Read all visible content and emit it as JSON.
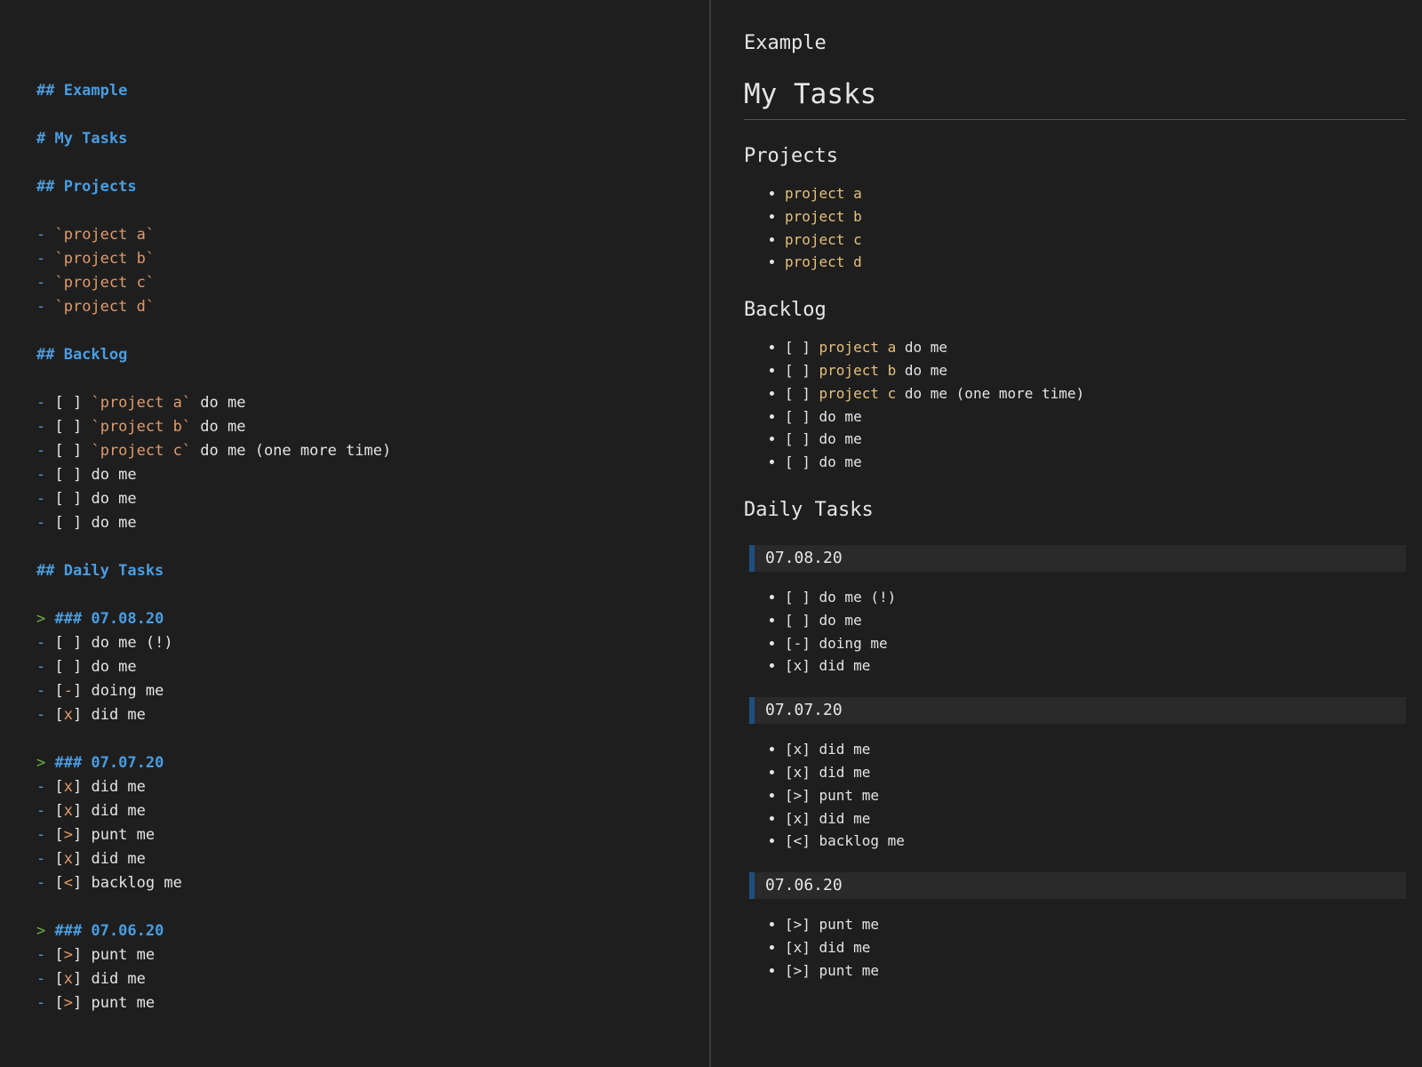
{
  "editor": {
    "lines": [
      {
        "k": "blank"
      },
      {
        "k": "h",
        "t": "## Example"
      },
      {
        "k": "blank"
      },
      {
        "k": "h",
        "t": "# My Tasks"
      },
      {
        "k": "blank"
      },
      {
        "k": "h",
        "t": "## Projects"
      },
      {
        "k": "blank"
      },
      {
        "k": "li",
        "code": "`project a`"
      },
      {
        "k": "li",
        "code": "`project b`"
      },
      {
        "k": "li",
        "code": "`project c`"
      },
      {
        "k": "li",
        "code": "`project d`"
      },
      {
        "k": "blank"
      },
      {
        "k": "h",
        "t": "## Backlog"
      },
      {
        "k": "blank"
      },
      {
        "k": "task",
        "box": " ",
        "code": "`project a`",
        "t": " do me"
      },
      {
        "k": "task",
        "box": " ",
        "code": "`project b`",
        "t": " do me"
      },
      {
        "k": "task",
        "box": " ",
        "code": "`project c`",
        "t": " do me (one more time)"
      },
      {
        "k": "task",
        "box": " ",
        "t": "do me"
      },
      {
        "k": "task",
        "box": " ",
        "t": "do me"
      },
      {
        "k": "task",
        "box": " ",
        "t": "do me"
      },
      {
        "k": "blank"
      },
      {
        "k": "h",
        "t": "## Daily Tasks"
      },
      {
        "k": "blank"
      },
      {
        "k": "bqh",
        "t": "### 07.08.20"
      },
      {
        "k": "task",
        "box": " ",
        "t": "do me (!)"
      },
      {
        "k": "task",
        "box": " ",
        "t": "do me"
      },
      {
        "k": "task",
        "box": "-",
        "t": "doing me"
      },
      {
        "k": "task",
        "box": "x",
        "t": "did me"
      },
      {
        "k": "blank"
      },
      {
        "k": "bqh",
        "t": "### 07.07.20"
      },
      {
        "k": "task",
        "box": "x",
        "t": "did me"
      },
      {
        "k": "task",
        "box": "x",
        "t": "did me"
      },
      {
        "k": "task",
        "box": ">",
        "t": "punt me"
      },
      {
        "k": "task",
        "box": "x",
        "t": "did me"
      },
      {
        "k": "task",
        "box": "<",
        "t": "backlog me"
      },
      {
        "k": "blank"
      },
      {
        "k": "bqh",
        "t": "### 07.06.20"
      },
      {
        "k": "task",
        "box": ">",
        "t": "punt me"
      },
      {
        "k": "task",
        "box": "x",
        "t": "did me"
      },
      {
        "k": "task",
        "box": ">",
        "t": "punt me"
      }
    ]
  },
  "preview": {
    "example": "Example",
    "title": "My Tasks",
    "projects_heading": "Projects",
    "projects": [
      "project a",
      "project b",
      "project c",
      "project d"
    ],
    "backlog_heading": "Backlog",
    "backlog": [
      {
        "box": "[ ]",
        "code": "project a",
        "t": "do me"
      },
      {
        "box": "[ ]",
        "code": "project b",
        "t": "do me"
      },
      {
        "box": "[ ]",
        "code": "project c",
        "t": "do me (one more time)"
      },
      {
        "box": "[ ]",
        "t": "do me"
      },
      {
        "box": "[ ]",
        "t": "do me"
      },
      {
        "box": "[ ]",
        "t": "do me"
      }
    ],
    "daily_heading": "Daily Tasks",
    "days": [
      {
        "date": "07.08.20",
        "items": [
          {
            "box": "[ ]",
            "t": "do me (!)"
          },
          {
            "box": "[ ]",
            "t": "do me"
          },
          {
            "box": "[-]",
            "t": "doing me"
          },
          {
            "box": "[x]",
            "t": "did me"
          }
        ]
      },
      {
        "date": "07.07.20",
        "items": [
          {
            "box": "[x]",
            "t": "did me"
          },
          {
            "box": "[x]",
            "t": "did me"
          },
          {
            "box": "[>]",
            "t": "punt me"
          },
          {
            "box": "[x]",
            "t": "did me"
          },
          {
            "box": "[<]",
            "t": "backlog me"
          }
        ]
      },
      {
        "date": "07.06.20",
        "items": [
          {
            "box": "[>]",
            "t": "punt me"
          },
          {
            "box": "[x]",
            "t": "did me"
          },
          {
            "box": "[>]",
            "t": "punt me"
          }
        ]
      }
    ]
  },
  "colors": {
    "background": "#1e1e1e",
    "heading": "#4a9de0",
    "inline_code_editor": "#e09a6a",
    "inline_code_preview": "#e5c07b",
    "blockquote_marker": "#6fb04a",
    "blockquote_bar": "#1e4f7d"
  }
}
